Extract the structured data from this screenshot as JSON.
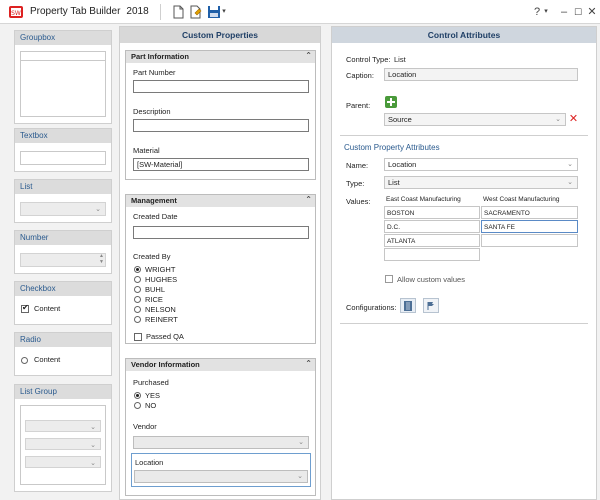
{
  "app": {
    "title": "Property Tab Builder",
    "version": "2018",
    "help_label": "?",
    "accent": "#2a5a8e"
  },
  "palette": {
    "groupbox": "Groupbox",
    "textbox": "Textbox",
    "list": "List",
    "number": "Number",
    "checkbox": "Checkbox",
    "checkbox_content": "Content",
    "radio": "Radio",
    "radio_content": "Content",
    "list_group": "List Group"
  },
  "custom": {
    "header": "Custom Properties",
    "part_info": {
      "title": "Part Information",
      "part_number_label": "Part Number",
      "part_number_value": "",
      "description_label": "Description",
      "description_value": "",
      "material_label": "Material",
      "material_value": "[SW-Material]"
    },
    "management": {
      "title": "Management",
      "created_date_label": "Created Date",
      "created_date_value": "",
      "created_by_label": "Created By",
      "options": [
        "WRIGHT",
        "HUGHES",
        "BUHL",
        "RICE",
        "NELSON",
        "REINERT"
      ],
      "selected": "WRIGHT",
      "passed_qa_label": "Passed QA"
    },
    "vendor": {
      "title": "Vendor Information",
      "purchased_label": "Purchased",
      "yes": "YES",
      "no": "NO",
      "vendor_label": "Vendor",
      "location_label": "Location"
    }
  },
  "control": {
    "header": "Control Attributes",
    "type_label": "Control Type:",
    "type_value": "List",
    "caption_label": "Caption:",
    "caption_value": "Location",
    "parent_label": "Parent:",
    "parent_value": "Source",
    "cpa_title": "Custom Property Attributes",
    "name_label": "Name:",
    "name_value": "Location",
    "type2_label": "Type:",
    "type2_value": "List",
    "values_label": "Values:",
    "columns": [
      "East Coast Manufacturing",
      "West Coast Manufacturing"
    ],
    "rows": [
      [
        "BOSTON",
        "SACRAMENTO"
      ],
      [
        "D.C.",
        "SANTA FE"
      ],
      [
        "ATLANTA",
        ""
      ],
      [
        "",
        ""
      ]
    ],
    "allow_custom_label": "Allow custom values",
    "configurations_label": "Configurations:"
  }
}
